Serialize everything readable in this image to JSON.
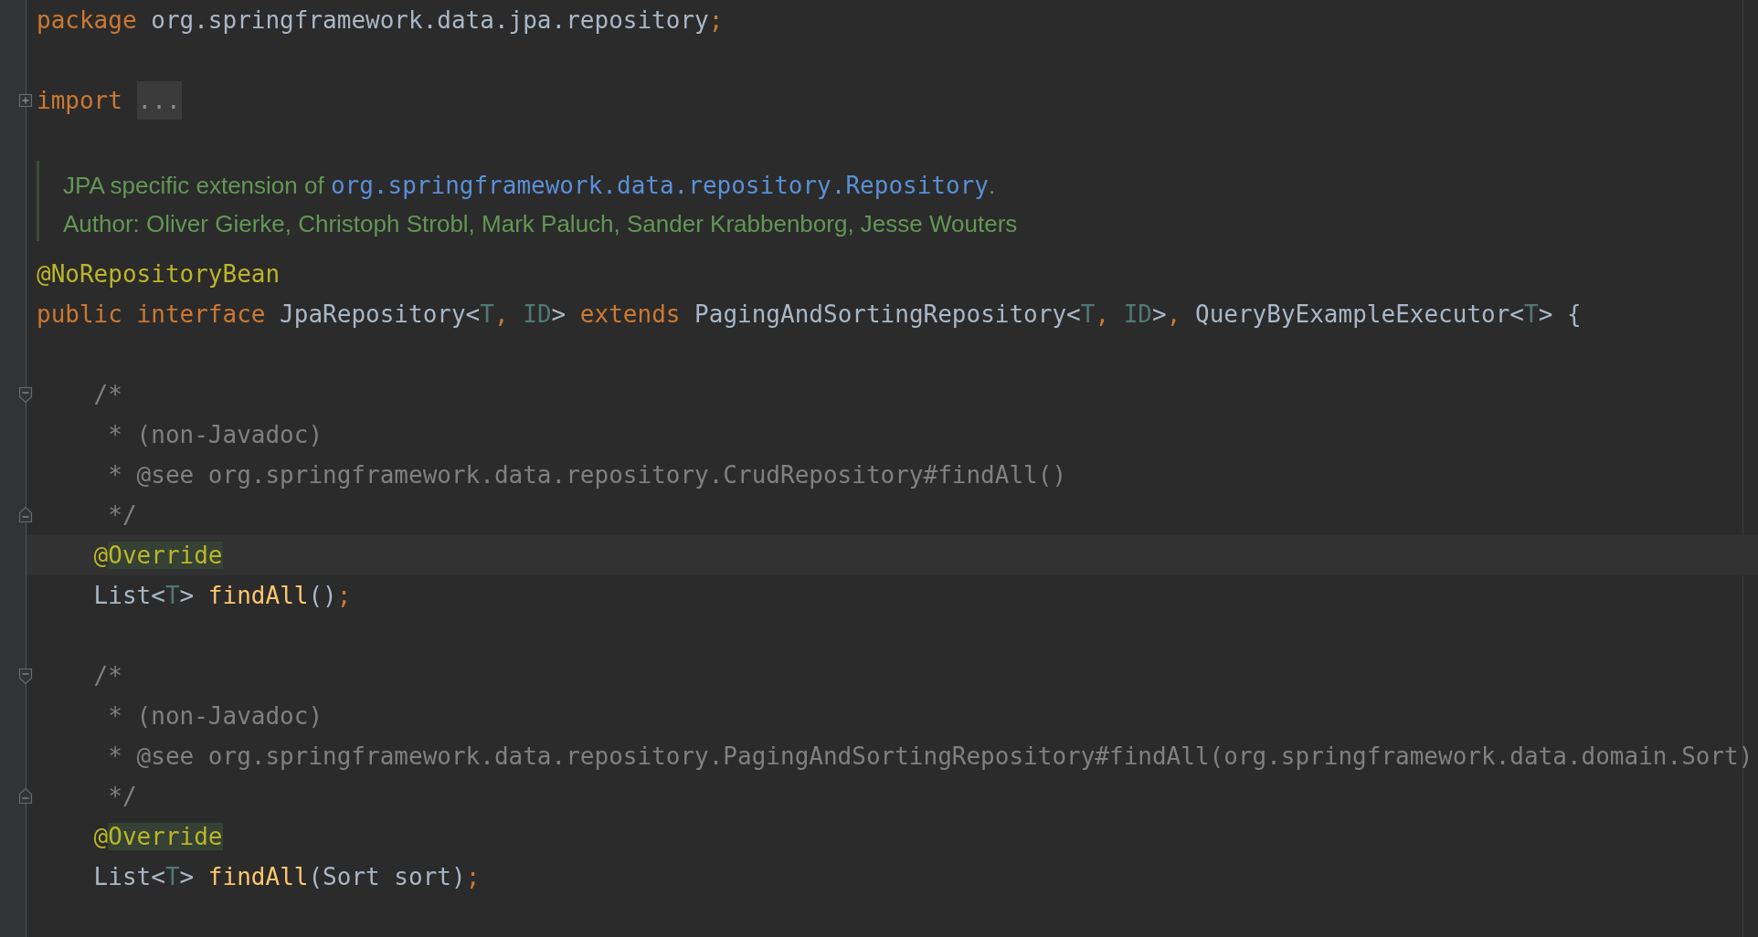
{
  "editor": {
    "lines": [
      {
        "kind": "code",
        "current": false,
        "tokens": [
          {
            "kind": "kw",
            "text": "package "
          },
          {
            "kind": "plain",
            "text": "org.springframework.data.jpa.repository"
          },
          {
            "kind": "punct",
            "text": ";"
          }
        ]
      },
      {
        "kind": "blank"
      },
      {
        "kind": "code",
        "current": false,
        "fold": {
          "kind": "expand"
        },
        "tokens": [
          {
            "kind": "kw",
            "text": "import "
          },
          {
            "kind": "folded",
            "text": "..."
          }
        ]
      },
      {
        "kind": "blank"
      },
      {
        "kind": "doc",
        "paragraphs": [
          {
            "text": "JPA specific extension of ",
            "link": "org.springframework.data.repository.Repository",
            "after": "."
          },
          {
            "text": "Author: Oliver Gierke, Christoph Strobl, Mark Paluch, Sander Krabbenborg, Jesse Wouters"
          }
        ]
      },
      {
        "kind": "code",
        "current": false,
        "tokens": [
          {
            "kind": "ann",
            "text": "@NoRepositoryBean"
          }
        ]
      },
      {
        "kind": "code",
        "current": false,
        "tokens": [
          {
            "kind": "kw",
            "text": "public interface "
          },
          {
            "kind": "plain",
            "text": "JpaRepository<"
          },
          {
            "kind": "tparam",
            "text": "T"
          },
          {
            "kind": "punct",
            "text": ", "
          },
          {
            "kind": "tparam",
            "text": "ID"
          },
          {
            "kind": "plain",
            "text": "> "
          },
          {
            "kind": "kw",
            "text": "extends "
          },
          {
            "kind": "plain",
            "text": "PagingAndSortingRepository<"
          },
          {
            "kind": "tparam",
            "text": "T"
          },
          {
            "kind": "punct",
            "text": ", "
          },
          {
            "kind": "tparam",
            "text": "ID"
          },
          {
            "kind": "plain",
            "text": ">"
          },
          {
            "kind": "punct",
            "text": ", "
          },
          {
            "kind": "plain",
            "text": "QueryByExampleExecutor<"
          },
          {
            "kind": "tparam",
            "text": "T"
          },
          {
            "kind": "plain",
            "text": "> {"
          }
        ]
      },
      {
        "kind": "blank"
      },
      {
        "kind": "code",
        "current": false,
        "fold": {
          "kind": "start"
        },
        "tokens": [
          {
            "kind": "comment",
            "text": "    /*"
          }
        ]
      },
      {
        "kind": "code",
        "current": false,
        "tokens": [
          {
            "kind": "comment",
            "text": "     * (non-Javadoc)"
          }
        ]
      },
      {
        "kind": "code",
        "current": false,
        "tokens": [
          {
            "kind": "comment",
            "text": "     * @see org.springframework.data.repository.CrudRepository#findAll()"
          }
        ]
      },
      {
        "kind": "code",
        "current": false,
        "fold": {
          "kind": "end"
        },
        "tokens": [
          {
            "kind": "comment",
            "text": "     */"
          }
        ]
      },
      {
        "kind": "code",
        "current": true,
        "tokens": [
          {
            "kind": "ann",
            "text": "    @"
          },
          {
            "kind": "ann",
            "highlighted": true,
            "text": "Override"
          }
        ]
      },
      {
        "kind": "code",
        "current": false,
        "tokens": [
          {
            "kind": "plain",
            "text": "    List<"
          },
          {
            "kind": "tparam",
            "text": "T"
          },
          {
            "kind": "plain",
            "text": "> "
          },
          {
            "kind": "fn",
            "text": "findAll"
          },
          {
            "kind": "plain",
            "text": "()"
          },
          {
            "kind": "punct",
            "text": ";"
          }
        ]
      },
      {
        "kind": "blank"
      },
      {
        "kind": "code",
        "current": false,
        "fold": {
          "kind": "start"
        },
        "tokens": [
          {
            "kind": "comment",
            "text": "    /*"
          }
        ]
      },
      {
        "kind": "code",
        "current": false,
        "tokens": [
          {
            "kind": "comment",
            "text": "     * (non-Javadoc)"
          }
        ]
      },
      {
        "kind": "code",
        "current": false,
        "tokens": [
          {
            "kind": "comment",
            "text": "     * @see org.springframework.data.repository.PagingAndSortingRepository#findAll(org.springframework.data.domain.Sort)"
          }
        ]
      },
      {
        "kind": "code",
        "current": false,
        "fold": {
          "kind": "end"
        },
        "tokens": [
          {
            "kind": "comment",
            "text": "     */"
          }
        ]
      },
      {
        "kind": "code",
        "current": false,
        "tokens": [
          {
            "kind": "ann",
            "text": "    @"
          },
          {
            "kind": "ann",
            "highlighted": true,
            "text": "Override"
          }
        ]
      },
      {
        "kind": "code",
        "current": false,
        "tokens": [
          {
            "kind": "plain",
            "text": "    List<"
          },
          {
            "kind": "tparam",
            "text": "T"
          },
          {
            "kind": "plain",
            "text": "> "
          },
          {
            "kind": "fn",
            "text": "findAll"
          },
          {
            "kind": "plain",
            "text": "(Sort sort)"
          },
          {
            "kind": "punct",
            "text": ";"
          }
        ]
      }
    ]
  }
}
